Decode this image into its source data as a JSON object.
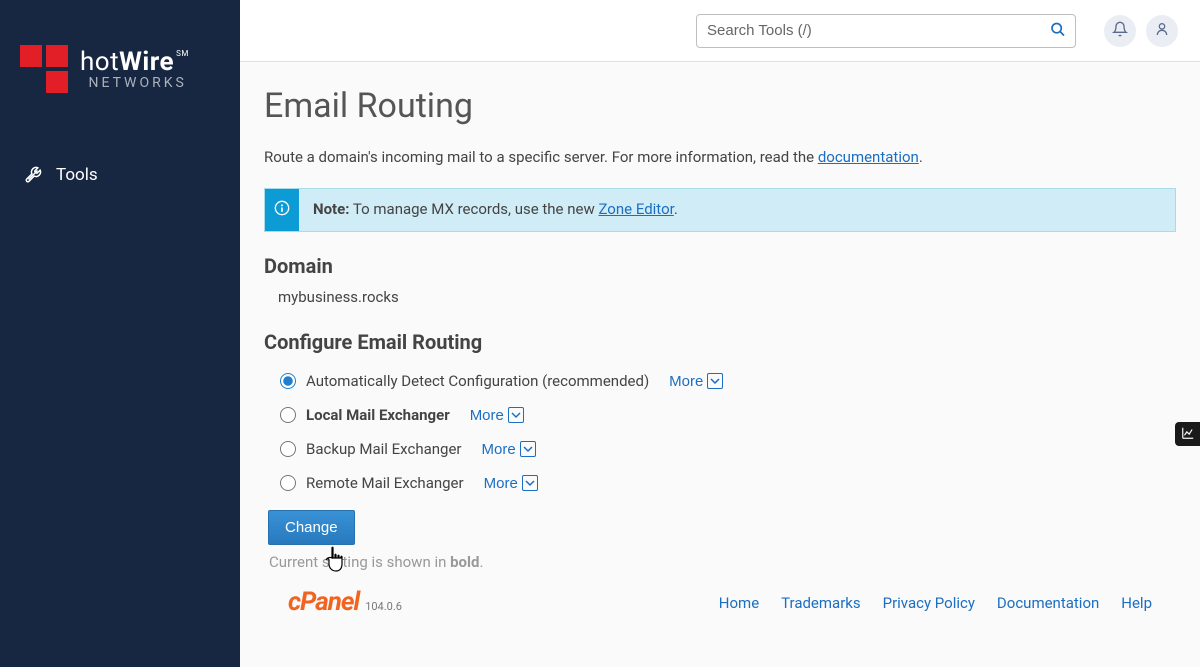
{
  "sidebar": {
    "tools_label": "Tools"
  },
  "topbar": {
    "search_placeholder": "Search Tools (/)"
  },
  "page": {
    "title": "Email Routing",
    "description_prefix": "Route a domain's incoming mail to a specific server. For more information, read the ",
    "description_link": "documentation",
    "description_suffix": "."
  },
  "info_banner": {
    "note_label": "Note:",
    "text_prefix": " To manage MX records, use the new ",
    "link_text": "Zone Editor",
    "text_suffix": "."
  },
  "domain": {
    "heading": "Domain",
    "value": "mybusiness.rocks"
  },
  "routing": {
    "heading": "Configure Email Routing",
    "options": [
      {
        "label": "Automatically Detect Configuration (recommended)",
        "selected": true,
        "bold": false
      },
      {
        "label": "Local Mail Exchanger",
        "selected": false,
        "bold": true
      },
      {
        "label": "Backup Mail Exchanger",
        "selected": false,
        "bold": false
      },
      {
        "label": "Remote Mail Exchanger",
        "selected": false,
        "bold": false
      }
    ],
    "more_label": "More",
    "change_button": "Change",
    "current_setting_prefix": "Current setting is shown in ",
    "current_setting_bold": "bold",
    "current_setting_suffix": "."
  },
  "footer": {
    "version": "104.0.6",
    "links": [
      "Home",
      "Trademarks",
      "Privacy Policy",
      "Documentation",
      "Help"
    ]
  }
}
